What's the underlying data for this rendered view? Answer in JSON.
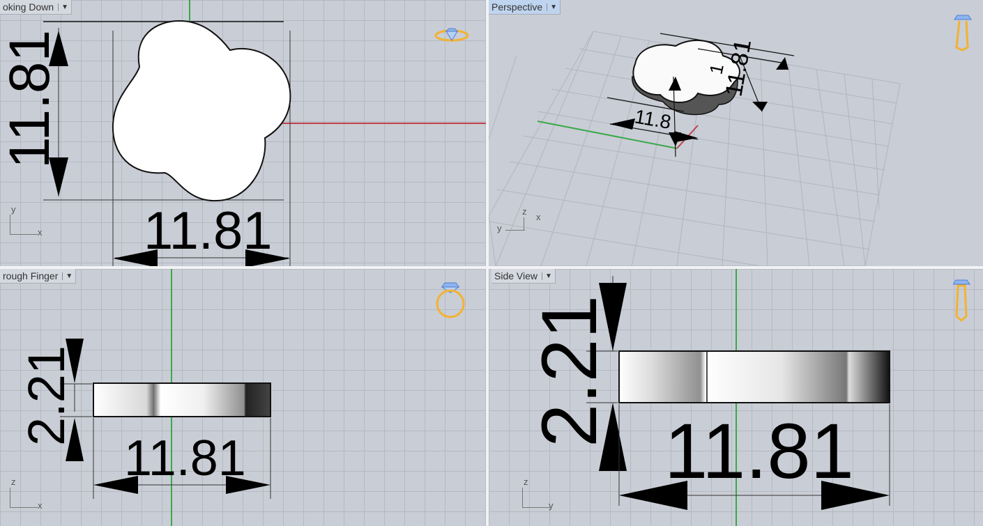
{
  "viewports": {
    "top": {
      "label": "oking Down",
      "axis": {
        "y": "y",
        "x": "x"
      },
      "dims": {
        "vertical": "11.81",
        "horizontal": "11.81"
      }
    },
    "perspective": {
      "label": "Perspective",
      "axis": {
        "z": "z",
        "x": "x",
        "y": "y"
      },
      "dims": {
        "a": "11.81",
        "b": "1",
        "c": "11.8"
      }
    },
    "front": {
      "label": "rough Finger",
      "axis": {
        "z": "z",
        "x": "x"
      },
      "dims": {
        "vertical": "2.21",
        "horizontal": "11.81"
      }
    },
    "side": {
      "label": "Side View",
      "axis": {
        "z": "z",
        "y": "y"
      },
      "dims": {
        "vertical": "2.21",
        "horizontal": "11.81"
      }
    }
  },
  "colors": {
    "x_axis": "#c0404a",
    "y_axis": "#3aa84a",
    "gizmo": "#f2b233",
    "gem": "#4f7fd0"
  },
  "icons": [
    "ring-top-view-icon",
    "ring-perspective-icon",
    "ring-front-view-icon",
    "ring-side-view-icon",
    "viewport-menu-caret-icon"
  ]
}
